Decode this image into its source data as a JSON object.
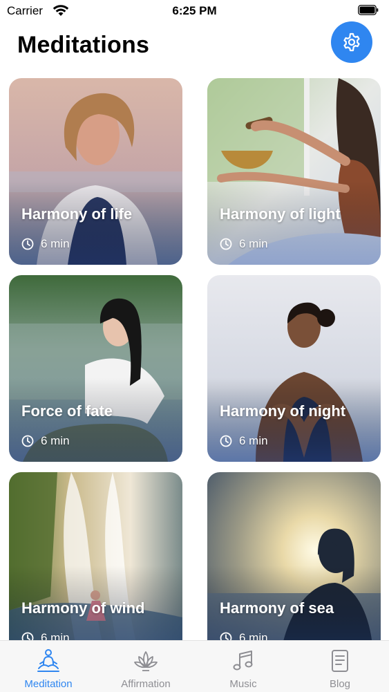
{
  "status_bar": {
    "carrier": "Carrier",
    "time": "6:25 PM"
  },
  "header": {
    "title": "Meditations"
  },
  "settings": {
    "icon": "gear-icon",
    "color": "#2f86f0"
  },
  "cards": [
    {
      "title": "Harmony of life",
      "duration": "6 min"
    },
    {
      "title": "Harmony of light",
      "duration": "6 min"
    },
    {
      "title": "Force of fate",
      "duration": "6 min"
    },
    {
      "title": "Harmony of night",
      "duration": "6 min"
    },
    {
      "title": "Harmony of wind",
      "duration": "6 min"
    },
    {
      "title": "Harmony of sea",
      "duration": "6 min"
    }
  ],
  "tabs": [
    {
      "label": "Meditation",
      "icon": "meditation-icon",
      "active": true
    },
    {
      "label": "Affirmation",
      "icon": "lotus-icon",
      "active": false
    },
    {
      "label": "Music",
      "icon": "music-note-icon",
      "active": false
    },
    {
      "label": "Blog",
      "icon": "document-icon",
      "active": false
    }
  ],
  "colors": {
    "accent": "#2f86f0",
    "inactive": "#8e8e93"
  }
}
